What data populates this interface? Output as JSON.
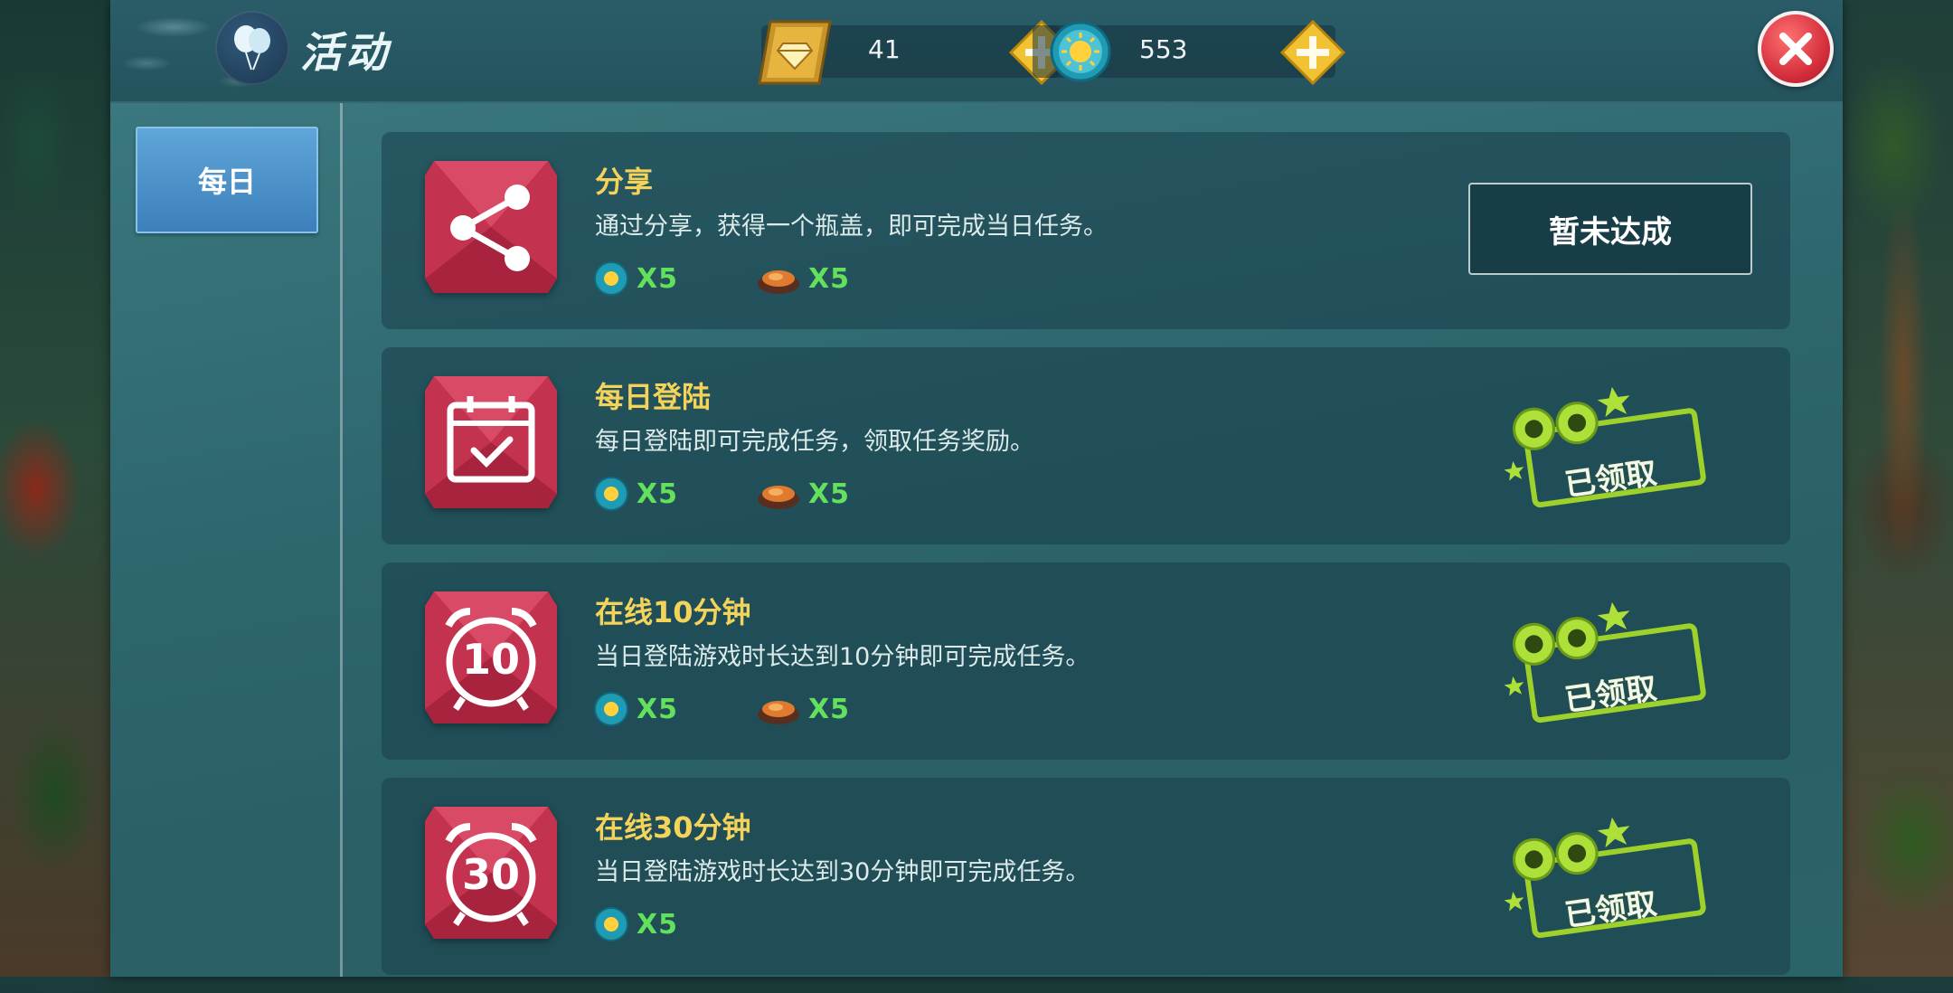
{
  "header": {
    "title": "活动"
  },
  "currencies": {
    "diamonds": {
      "icon": "diamond-card-icon",
      "value": "41"
    },
    "coins": {
      "icon": "sun-coin-icon",
      "value": "553"
    }
  },
  "sidebar": {
    "tabs": [
      {
        "label": "每日"
      }
    ]
  },
  "tasks": [
    {
      "title": "分享",
      "description": "通过分享，获得一个瓶盖，即可完成当日任务。",
      "icon": "share-icon",
      "rewards": [
        {
          "icon": "sun-coin-icon",
          "count": "X5"
        },
        {
          "icon": "food-plate-icon",
          "count": "X5"
        }
      ],
      "status": "暂未达成"
    },
    {
      "title": "每日登陆",
      "description": "每日登陆即可完成任务，领取任务奖励。",
      "icon": "calendar-check-icon",
      "rewards": [
        {
          "icon": "sun-coin-icon",
          "count": "X5"
        },
        {
          "icon": "food-plate-icon",
          "count": "X5"
        }
      ],
      "status": "已领取"
    },
    {
      "title": "在线10分钟",
      "description": "当日登陆游戏时长达到10分钟即可完成任务。",
      "icon": "alarm-clock-icon",
      "icon_number": "10",
      "rewards": [
        {
          "icon": "sun-coin-icon",
          "count": "X5"
        },
        {
          "icon": "food-plate-icon",
          "count": "X5"
        }
      ],
      "status": "已领取"
    },
    {
      "title": "在线30分钟",
      "description": "当日登陆游戏时长达到30分钟即可完成任务。",
      "icon": "alarm-clock-icon",
      "icon_number": "30",
      "rewards": [
        {
          "icon": "sun-coin-icon",
          "count": "X5"
        }
      ],
      "status": "已领取"
    }
  ],
  "colors": {
    "accent_yellow": "#f3d35a",
    "reward_green": "#63e05c",
    "tab_blue": "#4a90c8",
    "close_red": "#d22c3a"
  }
}
